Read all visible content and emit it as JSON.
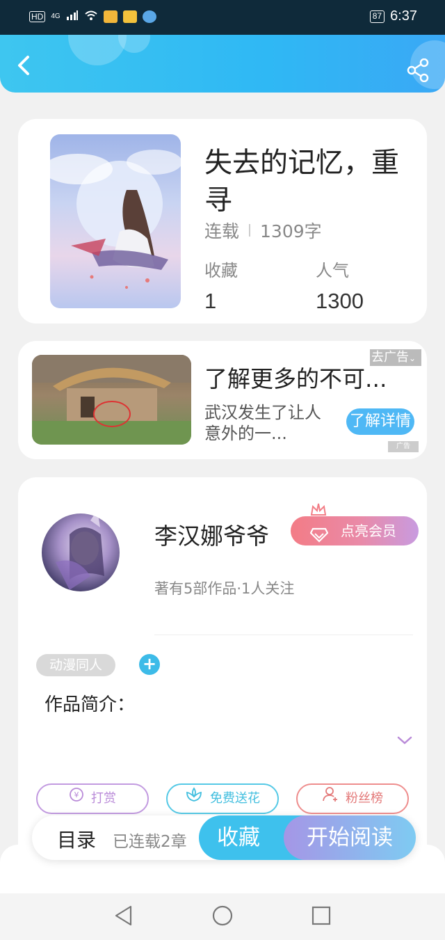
{
  "status_bar": {
    "left_indicators": [
      "HD",
      "4G"
    ],
    "battery": "87",
    "time": "6:37"
  },
  "header": {
    "back_icon": "chevron-left-icon",
    "share_icon": "share-icon"
  },
  "book": {
    "title": "失去的记忆，重寻",
    "status": "连载",
    "word_count": "1309字",
    "favorites_label": "收藏",
    "favorites_value": "1",
    "popularity_label": "人气",
    "popularity_value": "1300"
  },
  "ad": {
    "title": "了解更多的不可...",
    "description": "武汉发生了让人意外的一...",
    "close_tag": "去广告",
    "detail_button": "了解详情",
    "mark": "广告"
  },
  "author": {
    "name": "李汉娜爷爷",
    "vip_button": "点亮会员",
    "stats": "著有5部作品·1人关注",
    "tag": "动漫同人",
    "intro_label": "作品简介："
  },
  "actions": {
    "reward": "打赏",
    "flower": "免费送花",
    "fans": "粉丝榜"
  },
  "bottom_bar": {
    "toc": "目录",
    "chapters": "已连载2章",
    "collect": "收藏",
    "read": "开始阅读"
  },
  "colors": {
    "header": "#2fb8f4",
    "accent": "#3ec1ed",
    "vip": "#f37c86"
  }
}
